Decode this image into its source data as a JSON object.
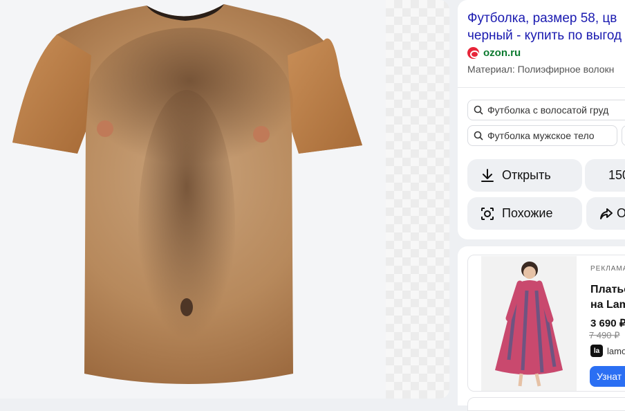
{
  "viewer": {
    "image_alt": "Hairy chest print t-shirt"
  },
  "result": {
    "title_line1": "Футболка, размер 58, цв",
    "title_line2": "черный - купить по выгод",
    "source_name": "ozon.ru",
    "source_icon": "ozon-logo-icon",
    "material": "Материал: Полиэфирное волокн"
  },
  "related_searches": [
    "Футболка с волосатой груд",
    "Футболка мужское тело"
  ],
  "actions": {
    "open_label": "Открыть",
    "size_label": "150",
    "similar_label": "Похожие",
    "share_label": "О"
  },
  "ad": {
    "label": "РЕКЛАМА",
    "title_line1": "Платье",
    "title_line2": "на Lam",
    "price": "3 690 ₽",
    "old_price": "7 490 ₽",
    "shop": "lamo",
    "shop_logo": "la",
    "cta": "Узнат"
  },
  "colors": {
    "title_link": "#1a1ab0",
    "source_green": "#0c7a2f",
    "ozon_red": "#e7263a",
    "cta_blue": "#2b6ff3"
  }
}
